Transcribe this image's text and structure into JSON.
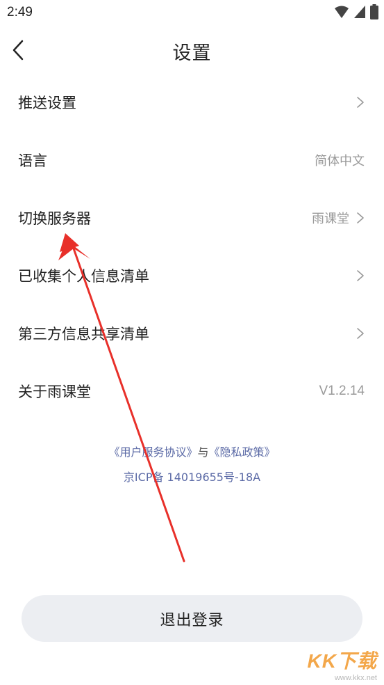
{
  "status_bar": {
    "time": "2:49",
    "icons": [
      "wifi-icon",
      "signal-icon",
      "battery-icon"
    ]
  },
  "header": {
    "title": "设置",
    "back_icon": "chevron-left-icon"
  },
  "menu": [
    {
      "id": "push",
      "label": "推送设置",
      "value": "",
      "chevron": true
    },
    {
      "id": "language",
      "label": "语言",
      "value": "简体中文",
      "chevron": false
    },
    {
      "id": "server",
      "label": "切换服务器",
      "value": "雨课堂",
      "chevron": true
    },
    {
      "id": "collected-info",
      "label": "已收集个人信息清单",
      "value": "",
      "chevron": true
    },
    {
      "id": "third-party",
      "label": "第三方信息共享清单",
      "value": "",
      "chevron": true
    },
    {
      "id": "about",
      "label": "关于雨课堂",
      "value": "V1.2.14",
      "chevron": false
    }
  ],
  "legal": {
    "user_agreement": "《用户服务协议》",
    "separator": "与",
    "privacy_policy": "《隐私政策》",
    "icp": "京ICP备 14019655号-18A"
  },
  "logout": {
    "label": "退出登录"
  },
  "watermark": {
    "logo": "KK下载",
    "url": "www.kkx.net"
  },
  "colors": {
    "link": "#5b6aa6",
    "button_bg": "#eceef2",
    "annotation_arrow": "#e8302a"
  }
}
